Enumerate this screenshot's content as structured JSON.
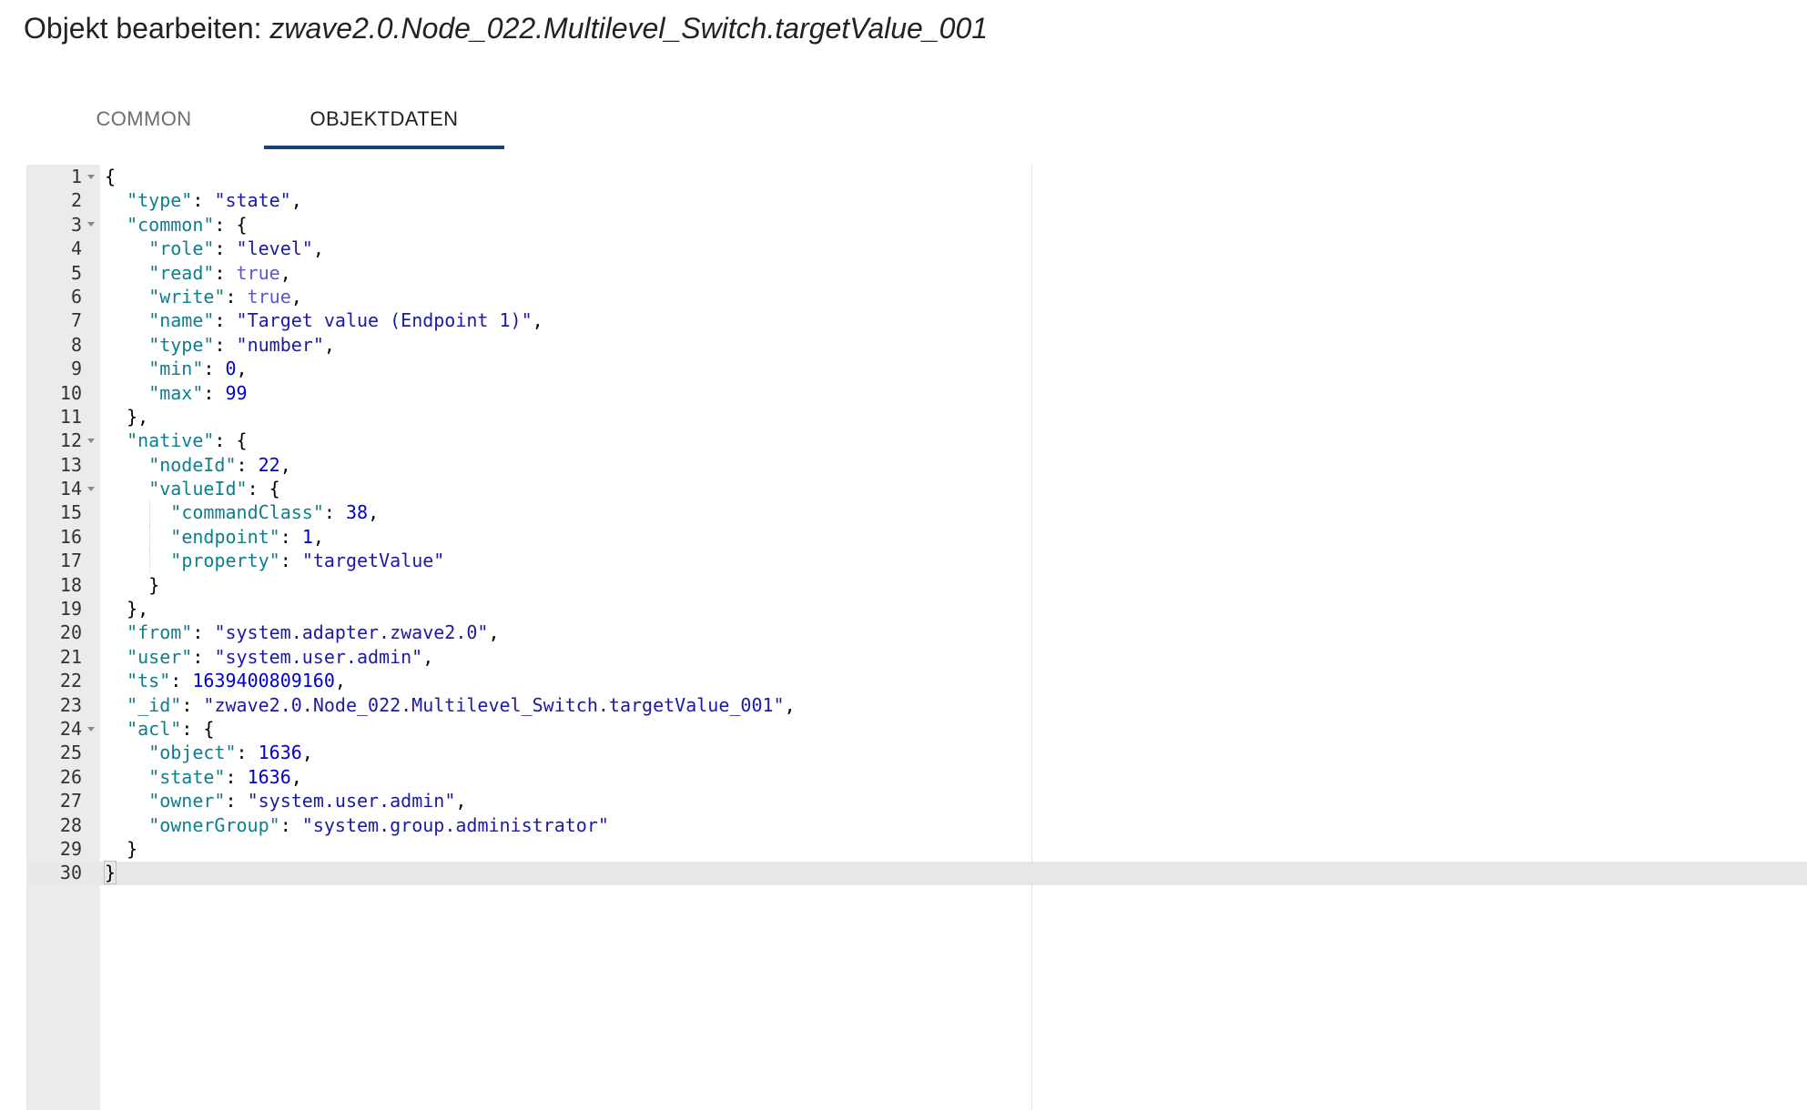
{
  "dialog": {
    "title_prefix": "Objekt bearbeiten: ",
    "object_id": "zwave2.0.Node_022.Multilevel_Switch.targetValue_001"
  },
  "tabs": [
    {
      "label": "COMMON",
      "active": false
    },
    {
      "label": "OBJEKTDATEN",
      "active": true
    }
  ],
  "editor": {
    "active_line": 30,
    "lines": [
      {
        "n": "1",
        "fold": true,
        "indent": 0,
        "tokens": [
          {
            "t": "p",
            "v": "{"
          }
        ]
      },
      {
        "n": "2",
        "fold": false,
        "indent": 1,
        "tokens": [
          {
            "t": "k",
            "v": "\"type\""
          },
          {
            "t": "p",
            "v": ": "
          },
          {
            "t": "s",
            "v": "\"state\""
          },
          {
            "t": "p",
            "v": ","
          }
        ]
      },
      {
        "n": "3",
        "fold": true,
        "indent": 1,
        "tokens": [
          {
            "t": "k",
            "v": "\"common\""
          },
          {
            "t": "p",
            "v": ": {"
          }
        ]
      },
      {
        "n": "4",
        "fold": false,
        "indent": 2,
        "tokens": [
          {
            "t": "k",
            "v": "\"role\""
          },
          {
            "t": "p",
            "v": ": "
          },
          {
            "t": "s",
            "v": "\"level\""
          },
          {
            "t": "p",
            "v": ","
          }
        ]
      },
      {
        "n": "5",
        "fold": false,
        "indent": 2,
        "tokens": [
          {
            "t": "k",
            "v": "\"read\""
          },
          {
            "t": "p",
            "v": ": "
          },
          {
            "t": "b",
            "v": "true"
          },
          {
            "t": "p",
            "v": ","
          }
        ]
      },
      {
        "n": "6",
        "fold": false,
        "indent": 2,
        "tokens": [
          {
            "t": "k",
            "v": "\"write\""
          },
          {
            "t": "p",
            "v": ": "
          },
          {
            "t": "b",
            "v": "true"
          },
          {
            "t": "p",
            "v": ","
          }
        ]
      },
      {
        "n": "7",
        "fold": false,
        "indent": 2,
        "tokens": [
          {
            "t": "k",
            "v": "\"name\""
          },
          {
            "t": "p",
            "v": ": "
          },
          {
            "t": "s",
            "v": "\"Target value (Endpoint 1)\""
          },
          {
            "t": "p",
            "v": ","
          }
        ]
      },
      {
        "n": "8",
        "fold": false,
        "indent": 2,
        "tokens": [
          {
            "t": "k",
            "v": "\"type\""
          },
          {
            "t": "p",
            "v": ": "
          },
          {
            "t": "s",
            "v": "\"number\""
          },
          {
            "t": "p",
            "v": ","
          }
        ]
      },
      {
        "n": "9",
        "fold": false,
        "indent": 2,
        "tokens": [
          {
            "t": "k",
            "v": "\"min\""
          },
          {
            "t": "p",
            "v": ": "
          },
          {
            "t": "n",
            "v": "0"
          },
          {
            "t": "p",
            "v": ","
          }
        ]
      },
      {
        "n": "10",
        "fold": false,
        "indent": 2,
        "tokens": [
          {
            "t": "k",
            "v": "\"max\""
          },
          {
            "t": "p",
            "v": ": "
          },
          {
            "t": "n",
            "v": "99"
          }
        ]
      },
      {
        "n": "11",
        "fold": false,
        "indent": 1,
        "tokens": [
          {
            "t": "p",
            "v": "},"
          }
        ]
      },
      {
        "n": "12",
        "fold": true,
        "indent": 1,
        "tokens": [
          {
            "t": "k",
            "v": "\"native\""
          },
          {
            "t": "p",
            "v": ": {"
          }
        ]
      },
      {
        "n": "13",
        "fold": false,
        "indent": 2,
        "tokens": [
          {
            "t": "k",
            "v": "\"nodeId\""
          },
          {
            "t": "p",
            "v": ": "
          },
          {
            "t": "n",
            "v": "22"
          },
          {
            "t": "p",
            "v": ","
          }
        ]
      },
      {
        "n": "14",
        "fold": true,
        "indent": 2,
        "tokens": [
          {
            "t": "k",
            "v": "\"valueId\""
          },
          {
            "t": "p",
            "v": ": {"
          }
        ]
      },
      {
        "n": "15",
        "fold": false,
        "indent": 3,
        "tokens": [
          {
            "t": "k",
            "v": "\"commandClass\""
          },
          {
            "t": "p",
            "v": ": "
          },
          {
            "t": "n",
            "v": "38"
          },
          {
            "t": "p",
            "v": ","
          }
        ]
      },
      {
        "n": "16",
        "fold": false,
        "indent": 3,
        "tokens": [
          {
            "t": "k",
            "v": "\"endpoint\""
          },
          {
            "t": "p",
            "v": ": "
          },
          {
            "t": "n",
            "v": "1"
          },
          {
            "t": "p",
            "v": ","
          }
        ]
      },
      {
        "n": "17",
        "fold": false,
        "indent": 3,
        "tokens": [
          {
            "t": "k",
            "v": "\"property\""
          },
          {
            "t": "p",
            "v": ": "
          },
          {
            "t": "s",
            "v": "\"targetValue\""
          }
        ]
      },
      {
        "n": "18",
        "fold": false,
        "indent": 2,
        "tokens": [
          {
            "t": "p",
            "v": "}"
          }
        ]
      },
      {
        "n": "19",
        "fold": false,
        "indent": 1,
        "tokens": [
          {
            "t": "p",
            "v": "},"
          }
        ]
      },
      {
        "n": "20",
        "fold": false,
        "indent": 1,
        "tokens": [
          {
            "t": "k",
            "v": "\"from\""
          },
          {
            "t": "p",
            "v": ": "
          },
          {
            "t": "s",
            "v": "\"system.adapter.zwave2.0\""
          },
          {
            "t": "p",
            "v": ","
          }
        ]
      },
      {
        "n": "21",
        "fold": false,
        "indent": 1,
        "tokens": [
          {
            "t": "k",
            "v": "\"user\""
          },
          {
            "t": "p",
            "v": ": "
          },
          {
            "t": "s",
            "v": "\"system.user.admin\""
          },
          {
            "t": "p",
            "v": ","
          }
        ]
      },
      {
        "n": "22",
        "fold": false,
        "indent": 1,
        "tokens": [
          {
            "t": "k",
            "v": "\"ts\""
          },
          {
            "t": "p",
            "v": ": "
          },
          {
            "t": "n",
            "v": "1639400809160"
          },
          {
            "t": "p",
            "v": ","
          }
        ]
      },
      {
        "n": "23",
        "fold": false,
        "indent": 1,
        "tokens": [
          {
            "t": "k",
            "v": "\"_id\""
          },
          {
            "t": "p",
            "v": ": "
          },
          {
            "t": "s",
            "v": "\"zwave2.0.Node_022.Multilevel_Switch.targetValue_001\""
          },
          {
            "t": "p",
            "v": ","
          }
        ]
      },
      {
        "n": "24",
        "fold": true,
        "indent": 1,
        "tokens": [
          {
            "t": "k",
            "v": "\"acl\""
          },
          {
            "t": "p",
            "v": ": {"
          }
        ]
      },
      {
        "n": "25",
        "fold": false,
        "indent": 2,
        "tokens": [
          {
            "t": "k",
            "v": "\"object\""
          },
          {
            "t": "p",
            "v": ": "
          },
          {
            "t": "n",
            "v": "1636"
          },
          {
            "t": "p",
            "v": ","
          }
        ]
      },
      {
        "n": "26",
        "fold": false,
        "indent": 2,
        "tokens": [
          {
            "t": "k",
            "v": "\"state\""
          },
          {
            "t": "p",
            "v": ": "
          },
          {
            "t": "n",
            "v": "1636"
          },
          {
            "t": "p",
            "v": ","
          }
        ]
      },
      {
        "n": "27",
        "fold": false,
        "indent": 2,
        "tokens": [
          {
            "t": "k",
            "v": "\"owner\""
          },
          {
            "t": "p",
            "v": ": "
          },
          {
            "t": "s",
            "v": "\"system.user.admin\""
          },
          {
            "t": "p",
            "v": ","
          }
        ]
      },
      {
        "n": "28",
        "fold": false,
        "indent": 2,
        "tokens": [
          {
            "t": "k",
            "v": "\"ownerGroup\""
          },
          {
            "t": "p",
            "v": ": "
          },
          {
            "t": "s",
            "v": "\"system.group.administrator\""
          }
        ]
      },
      {
        "n": "29",
        "fold": false,
        "indent": 1,
        "tokens": [
          {
            "t": "p",
            "v": "}"
          }
        ]
      },
      {
        "n": "30",
        "fold": false,
        "indent": 0,
        "tokens": [
          {
            "t": "p",
            "v": "}"
          }
        ]
      }
    ]
  },
  "colors": {
    "tab_indicator": "#164477",
    "gutter_bg": "#ebebeb",
    "json_key": "#0d7e8e",
    "json_string": "#1a1aa6",
    "json_number": "#0000cd",
    "json_boolean": "#5b58c9"
  },
  "icons": {
    "fold_toggle": "fold-arrow-icon"
  }
}
